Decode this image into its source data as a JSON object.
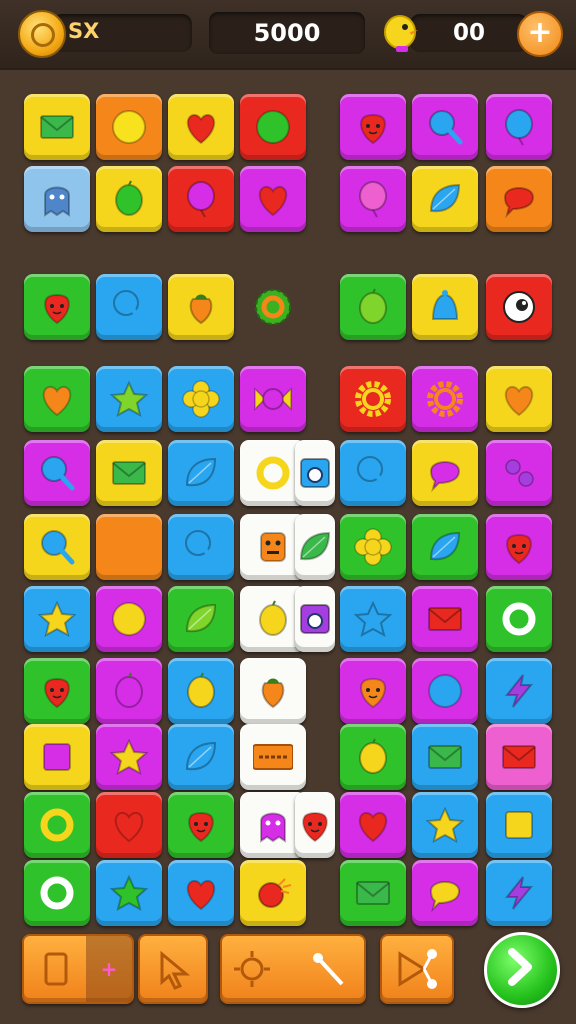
{
  "hud": {
    "coin_label": "SX",
    "score": "5000",
    "lives": "00",
    "plus_icon": "plus-icon",
    "coin_icon": "coin-icon",
    "bird_icon": "bird-icon"
  },
  "colors": {
    "yellow": "#f6d61c",
    "orange": "#f5871a",
    "red": "#e9281f",
    "magenta": "#d52ee6",
    "purple": "#a53ee0",
    "pink": "#ee5fd0",
    "green": "#2fc22b",
    "lime": "#7fd52c",
    "blue": "#2aa6f0",
    "lightblue": "#8fc4ec",
    "white": "#fbfbf7"
  },
  "tiles": [
    {
      "bg": "yellow",
      "icon": "envelope",
      "ic": "#3ab84a"
    },
    {
      "bg": "orange",
      "icon": "circle",
      "ic": "#f7e21d"
    },
    {
      "bg": "yellow",
      "icon": "heart",
      "ic": "#e9281f"
    },
    {
      "bg": "red",
      "icon": "circle",
      "ic": "#2fc22b"
    },
    {
      "bg": "magenta",
      "icon": "strawberry",
      "ic": "#e9281f"
    },
    {
      "bg": "magenta",
      "icon": "lollipop",
      "ic": "#2aa6f0"
    },
    {
      "bg": "magenta",
      "icon": "balloon",
      "ic": "#2aa6f0"
    },
    {
      "bg": "lightblue",
      "icon": "ghost",
      "ic": "#4f86c9"
    },
    {
      "bg": "yellow",
      "icon": "lime",
      "ic": "#2fc22b"
    },
    {
      "bg": "red",
      "icon": "balloon",
      "ic": "#d52ee6"
    },
    {
      "bg": "magenta",
      "icon": "heart",
      "ic": "#e9281f"
    },
    {
      "bg": "magenta",
      "icon": "balloon",
      "ic": "#ee5fd0"
    },
    {
      "bg": "yellow",
      "icon": "leaf",
      "ic": "#2aa6f0"
    },
    {
      "bg": "orange",
      "icon": "bubble",
      "ic": "#e9281f"
    },
    {
      "bg": "green",
      "icon": "strawberry",
      "ic": "#e9281f"
    },
    {
      "bg": "blue",
      "icon": "lollipop",
      "ic": "#2aa6f0"
    },
    {
      "bg": "yellow",
      "icon": "acorn",
      "ic": "#f5871a"
    },
    {
      "bg": "none",
      "icon": "gear-ring",
      "ic": "#3cb11f"
    },
    {
      "bg": "green",
      "icon": "lime",
      "ic": "#7fd52c"
    },
    {
      "bg": "yellow",
      "icon": "bell",
      "ic": "#2aa6f0"
    },
    {
      "bg": "red",
      "icon": "eye",
      "ic": "#ffffff"
    },
    {
      "bg": "green",
      "icon": "heart",
      "ic": "#f5871a"
    },
    {
      "bg": "blue",
      "icon": "star",
      "ic": "#7fd52c"
    },
    {
      "bg": "blue",
      "icon": "flower",
      "ic": "#f6d61c"
    },
    {
      "bg": "magenta",
      "icon": "candy",
      "ic": "#d52ee6"
    },
    {
      "bg": "red",
      "icon": "gear",
      "ic": "#f6d61c"
    },
    {
      "bg": "magenta",
      "icon": "gear",
      "ic": "#f5871a"
    },
    {
      "bg": "yellow",
      "icon": "heart",
      "ic": "#f5871a"
    },
    {
      "bg": "magenta",
      "icon": "lollipop",
      "ic": "#2aa6f0"
    },
    {
      "bg": "yellow",
      "icon": "envelope",
      "ic": "#3ab84a"
    },
    {
      "bg": "blue",
      "icon": "leaf",
      "ic": "#2aa6f0"
    },
    {
      "bg": "white",
      "icon": "ring",
      "ic": "#f6d61c"
    },
    {
      "bg": "white",
      "icon": "camera",
      "ic": "#2aa6f0"
    },
    {
      "bg": "blue",
      "icon": "lollipop",
      "ic": "#2aa6f0"
    },
    {
      "bg": "yellow",
      "icon": "bubble",
      "ic": "#d52ee6"
    },
    {
      "bg": "magenta",
      "icon": "dots",
      "ic": "#a53ee0"
    },
    {
      "bg": "yellow",
      "icon": "lollipop",
      "ic": "#2aa6f0"
    },
    {
      "bg": "orange",
      "icon": "gear",
      "ic": "#f5871a"
    },
    {
      "bg": "blue",
      "icon": "lollipop",
      "ic": "#2aa6f0"
    },
    {
      "bg": "white",
      "icon": "robot",
      "ic": "#f5871a"
    },
    {
      "bg": "white",
      "icon": "leaf",
      "ic": "#3ab84a"
    },
    {
      "bg": "green",
      "icon": "flower",
      "ic": "#f6d61c"
    },
    {
      "bg": "green",
      "icon": "leaf",
      "ic": "#2aa6f0"
    },
    {
      "bg": "magenta",
      "icon": "strawberry",
      "ic": "#e9281f"
    },
    {
      "bg": "blue",
      "icon": "star",
      "ic": "#f6d61c"
    },
    {
      "bg": "magenta",
      "icon": "circle",
      "ic": "#f6d61c"
    },
    {
      "bg": "green",
      "icon": "leaf",
      "ic": "#7fd52c"
    },
    {
      "bg": "white",
      "icon": "lime",
      "ic": "#f6d61c"
    },
    {
      "bg": "white",
      "icon": "camera",
      "ic": "#a53ee0"
    },
    {
      "bg": "blue",
      "icon": "star",
      "ic": "#2aa6f0"
    },
    {
      "bg": "magenta",
      "icon": "envelope",
      "ic": "#e9281f"
    },
    {
      "bg": "green",
      "icon": "ring",
      "ic": "#ffffff"
    },
    {
      "bg": "green",
      "icon": "strawberry",
      "ic": "#e9281f"
    },
    {
      "bg": "magenta",
      "icon": "lime",
      "ic": "#d52ee6"
    },
    {
      "bg": "blue",
      "icon": "lime",
      "ic": "#f6d61c"
    },
    {
      "bg": "white",
      "icon": "acorn",
      "ic": "#f5871a"
    },
    {
      "bg": "magenta",
      "icon": "strawberry",
      "ic": "#f5871a"
    },
    {
      "bg": "magenta",
      "icon": "circle",
      "ic": "#2aa6f0"
    },
    {
      "bg": "blue",
      "icon": "bolt",
      "ic": "#a53ee0"
    },
    {
      "bg": "yellow",
      "icon": "square",
      "ic": "#d52ee6"
    },
    {
      "bg": "magenta",
      "icon": "star",
      "ic": "#f6d61c"
    },
    {
      "bg": "blue",
      "icon": "leaf",
      "ic": "#2aa6f0"
    },
    {
      "bg": "white",
      "icon": "label",
      "ic": "#f5871a"
    },
    {
      "bg": "green",
      "icon": "lime",
      "ic": "#f6d61c"
    },
    {
      "bg": "blue",
      "icon": "envelope",
      "ic": "#3ab84a"
    },
    {
      "bg": "pink",
      "icon": "envelope",
      "ic": "#e9281f"
    },
    {
      "bg": "green",
      "icon": "ring",
      "ic": "#f6d61c"
    },
    {
      "bg": "red",
      "icon": "heart",
      "ic": "#e9281f"
    },
    {
      "bg": "green",
      "icon": "strawberry",
      "ic": "#e9281f"
    },
    {
      "bg": "white",
      "icon": "ghost",
      "ic": "#d52ee6"
    },
    {
      "bg": "white",
      "icon": "strawberry",
      "ic": "#e9281f"
    },
    {
      "bg": "magenta",
      "icon": "heart",
      "ic": "#e9281f"
    },
    {
      "bg": "blue",
      "icon": "star",
      "ic": "#f6d61c"
    },
    {
      "bg": "blue",
      "icon": "square",
      "ic": "#f6d61c"
    },
    {
      "bg": "green",
      "icon": "ring",
      "ic": "#ffffff"
    },
    {
      "bg": "blue",
      "icon": "star",
      "ic": "#2fc22b"
    },
    {
      "bg": "blue",
      "icon": "heart",
      "ic": "#e9281f"
    },
    {
      "bg": "yellow",
      "icon": "bomb",
      "ic": "#e9281f"
    },
    {
      "bg": "green",
      "icon": "envelope",
      "ic": "#3ab84a"
    },
    {
      "bg": "magenta",
      "icon": "bubble",
      "ic": "#f6d61c"
    },
    {
      "bg": "blue",
      "icon": "bolt",
      "ic": "#a53ee0"
    }
  ],
  "toolbar": {
    "buttons": [
      "hammer-icon",
      "plus-icon",
      "cursor-icon",
      "sparkle-wand-icon",
      "share-icon"
    ],
    "go_icon": "chevron-right-icon"
  }
}
